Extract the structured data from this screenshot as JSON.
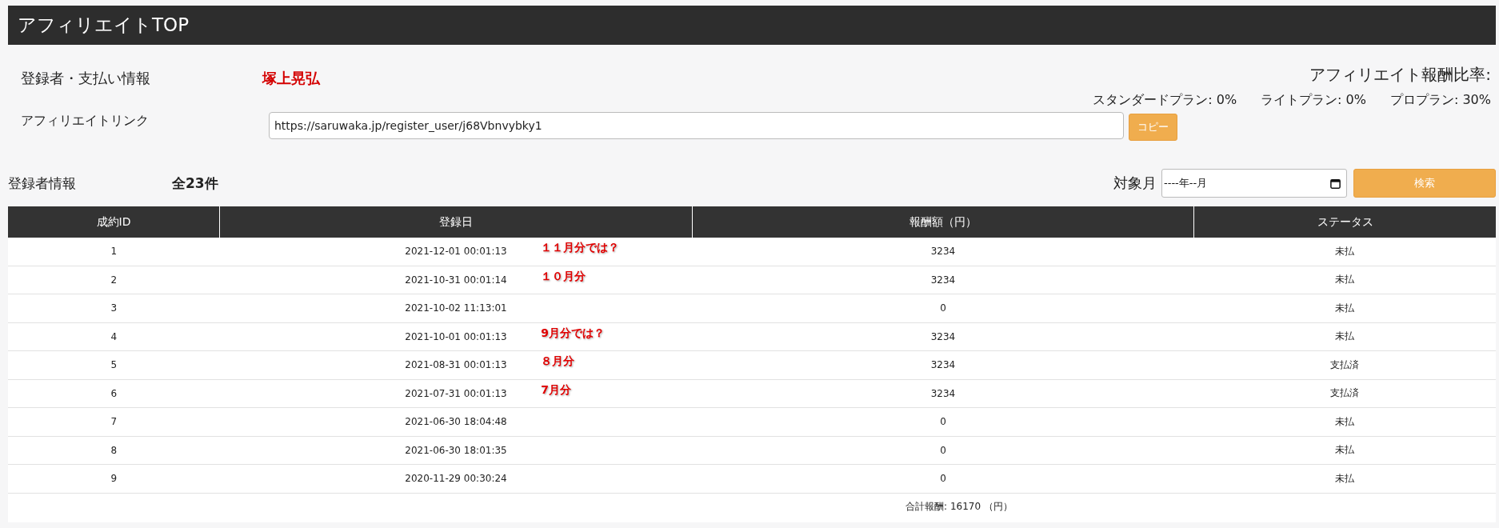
{
  "header": {
    "title": "アフィリエイトTOP"
  },
  "registrant": {
    "label": "登録者・支払い情報",
    "name": "塚上晃弘"
  },
  "commission": {
    "title": "アフィリエイト報酬比率:",
    "plans": [
      {
        "label": "スタンダードプラン: 0%"
      },
      {
        "label": "ライトプラン: 0%"
      },
      {
        "label": "プロプラン: 30%"
      }
    ]
  },
  "affiliate_link": {
    "label": "アフィリエイトリンク",
    "value": "https://saruwaka.jp/register_user/j68Vbnvybky1",
    "copy_button": "コピー"
  },
  "registrants": {
    "label": "登録者情報",
    "count": "全23件"
  },
  "filter": {
    "label": "対象月",
    "placeholder": "----年--月",
    "search_button": "検索"
  },
  "table": {
    "columns": [
      "成約ID",
      "登録日",
      "報酬額（円）",
      "ステータス"
    ],
    "rows": [
      {
        "id": "1",
        "date": "2021-12-01 00:01:13",
        "amount": "3234",
        "status": "未払",
        "note": "１１月分では？"
      },
      {
        "id": "2",
        "date": "2021-10-31 00:01:14",
        "amount": "3234",
        "status": "未払",
        "note": "１０月分"
      },
      {
        "id": "3",
        "date": "2021-10-02 11:13:01",
        "amount": "0",
        "status": "未払"
      },
      {
        "id": "4",
        "date": "2021-10-01 00:01:13",
        "amount": "3234",
        "status": "未払",
        "note": "9月分では？"
      },
      {
        "id": "5",
        "date": "2021-08-31 00:01:13",
        "amount": "3234",
        "status": "支払済",
        "note": "８月分"
      },
      {
        "id": "6",
        "date": "2021-07-31 00:01:13",
        "amount": "3234",
        "status": "支払済",
        "note": "7月分"
      },
      {
        "id": "7",
        "date": "2021-06-30 18:04:48",
        "amount": "0",
        "status": "未払"
      },
      {
        "id": "8",
        "date": "2021-06-30 18:01:35",
        "amount": "0",
        "status": "未払"
      },
      {
        "id": "9",
        "date": "2020-11-29 00:30:24",
        "amount": "0",
        "status": "未払"
      }
    ],
    "total": "合計報酬: 16170 （円）"
  }
}
